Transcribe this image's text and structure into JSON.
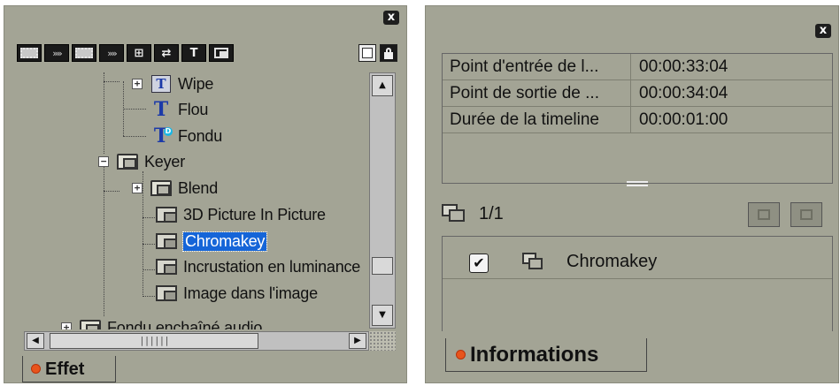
{
  "effects_panel": {
    "close_label": "x",
    "toolbar_icons": [
      "film-strip",
      "transition-arrows",
      "film-strip",
      "transition-arrows",
      "keyer",
      "keyer-arrows",
      "title-text",
      "picture-in-picture"
    ],
    "tree": {
      "wipe": "Wipe",
      "flou": "Flou",
      "fondu": "Fondu",
      "keyer": "Keyer",
      "blend": "Blend",
      "pip3d": "3D Picture In Picture",
      "chromakey": "Chromakey",
      "incrustation": "Incrustation en luminance",
      "image_dans_image": "Image dans l'image",
      "fondu_audio": "Fondu enchaîné audio"
    },
    "tab_label": "Effet"
  },
  "info_panel": {
    "close_label": "x",
    "rows": [
      {
        "label": "Point d'entrée de l...",
        "value": "00:00:33:04"
      },
      {
        "label": "Point de sortie de ...",
        "value": "00:00:34:04"
      },
      {
        "label": "Durée de la timeline",
        "value": "00:00:01:00"
      }
    ],
    "page_counter": "1/1",
    "effect": {
      "name": "Chromakey",
      "checked": true
    },
    "tab_label": "Informations"
  }
}
